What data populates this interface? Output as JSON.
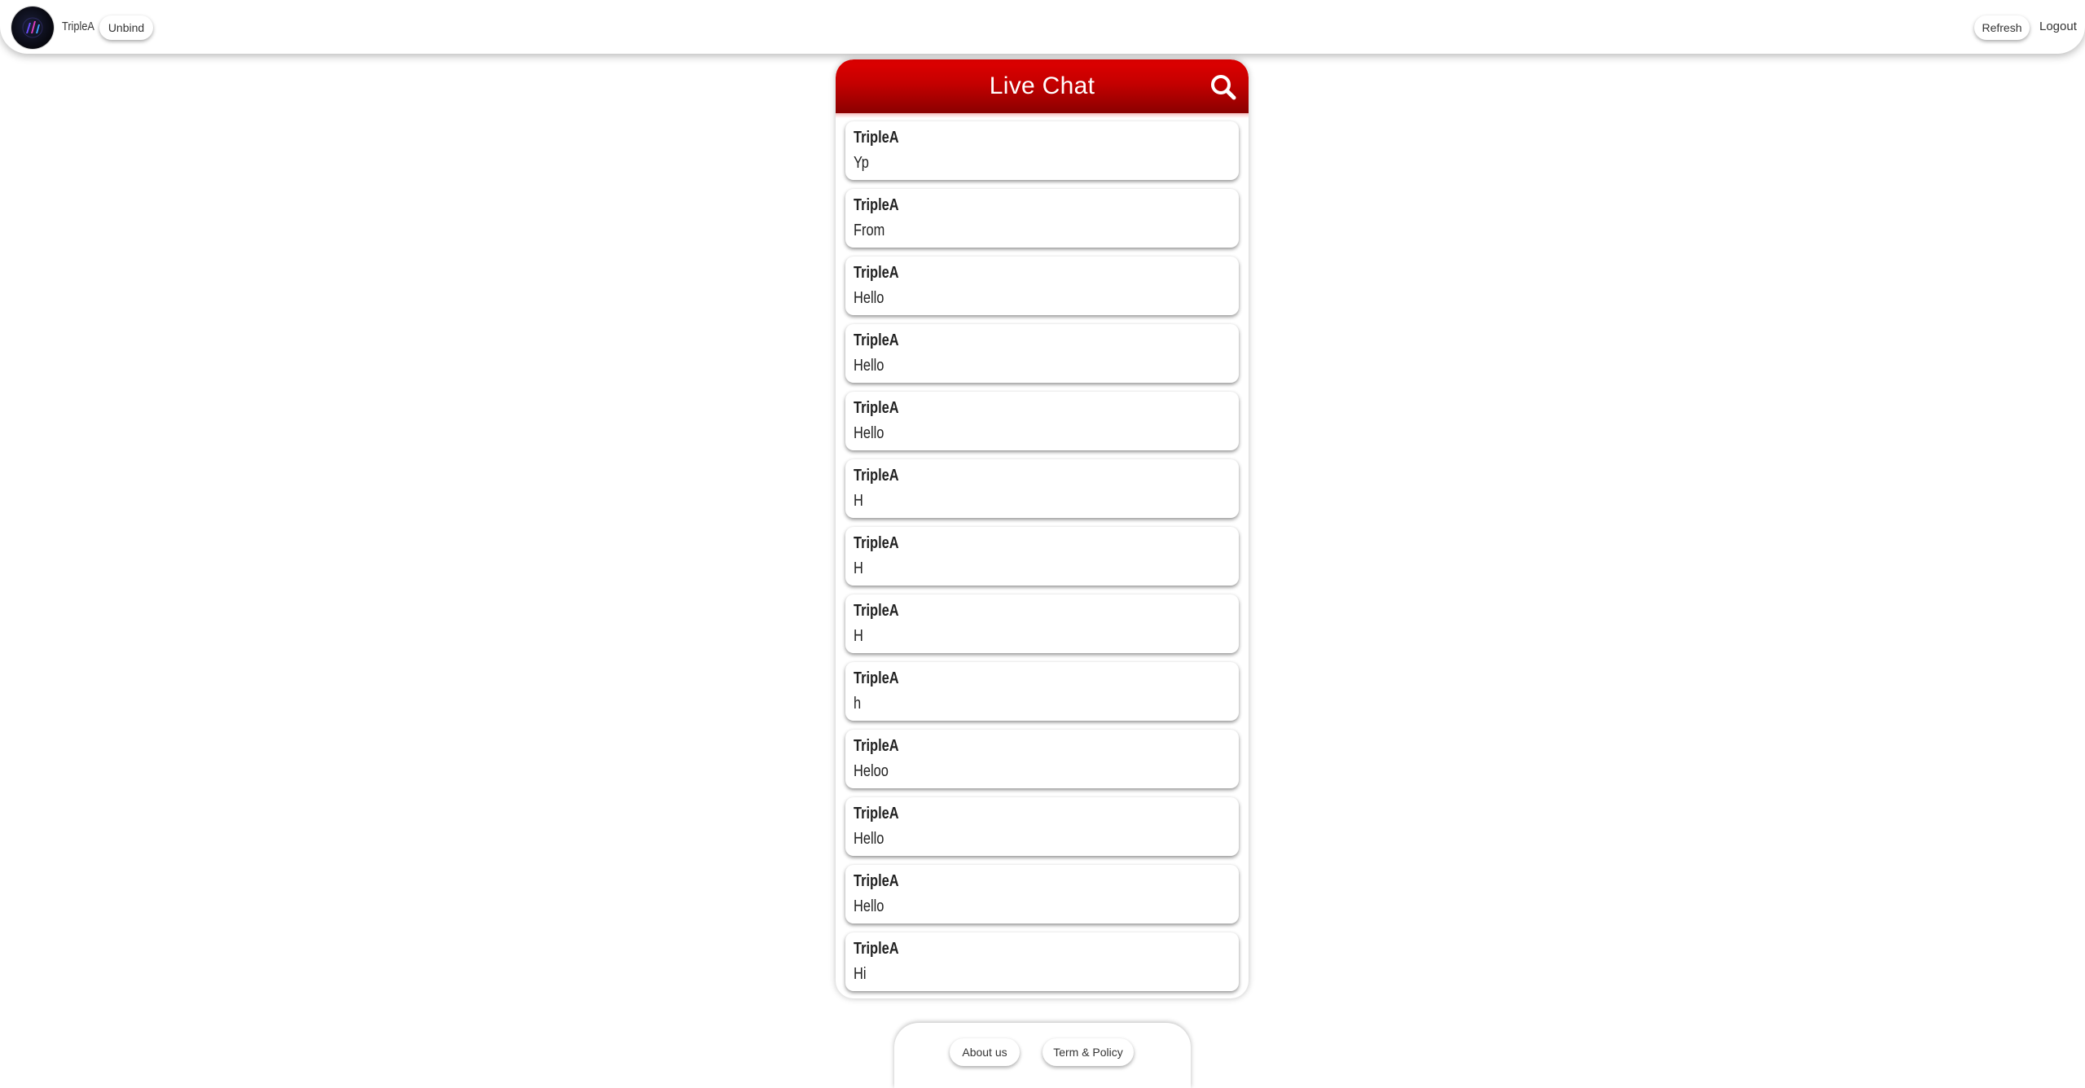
{
  "header": {
    "username": "TripleA",
    "unbind_label": "Unbind",
    "refresh_label": "Refresh",
    "logout_label": "Logout",
    "avatar_icon": "logo-avatar"
  },
  "chat": {
    "title": "Live Chat",
    "search_icon": "search-icon",
    "header_color": "#d40000",
    "messages": [
      {
        "author": "TripleA",
        "text": "Yp"
      },
      {
        "author": "TripleA",
        "text": "From"
      },
      {
        "author": "TripleA",
        "text": "Hello"
      },
      {
        "author": "TripleA",
        "text": "Hello"
      },
      {
        "author": "TripleA",
        "text": "Hello"
      },
      {
        "author": "TripleA",
        "text": "H"
      },
      {
        "author": "TripleA",
        "text": "H"
      },
      {
        "author": "TripleA",
        "text": "H"
      },
      {
        "author": "TripleA",
        "text": "h"
      },
      {
        "author": "TripleA",
        "text": "Heloo"
      },
      {
        "author": "TripleA",
        "text": "Hello"
      },
      {
        "author": "TripleA",
        "text": "Hello"
      },
      {
        "author": "TripleA",
        "text": "Hi"
      }
    ]
  },
  "footer": {
    "about_label": "About us",
    "terms_label": "Term & Policy"
  }
}
